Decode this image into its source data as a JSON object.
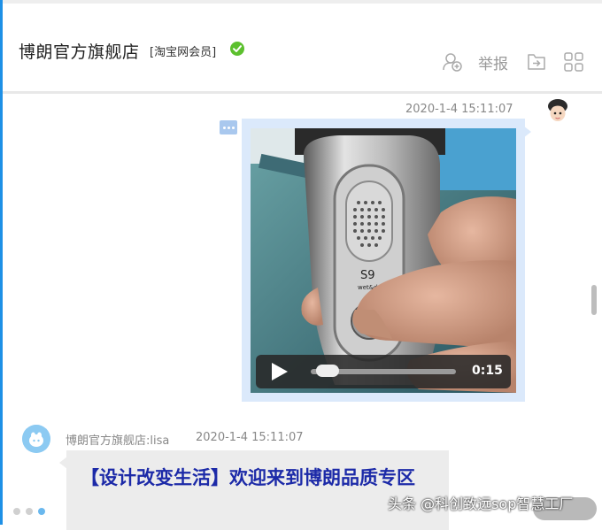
{
  "header": {
    "shop_name": "博朗官方旗舰店",
    "member_tag": "[淘宝网会员]",
    "report_label": "举报",
    "icons": [
      "verified-check-icon",
      "add-contact-icon",
      "transfer-icon",
      "grid-apps-icon"
    ]
  },
  "chat": {
    "my_message": {
      "timestamp": "2020-1-4 15:11:07",
      "type": "video",
      "video_model_label": "S9",
      "video_sub_label": "wet&dry",
      "video_duration": "0:15",
      "progress": 0.05
    },
    "shop_message": {
      "sender": "博朗官方旗舰店:lisa",
      "timestamp": "2020-1-4 15:11:07",
      "text": "【设计改变生活】欢迎来到博朗品质专区"
    }
  },
  "watermark": "头条 @科创致远sop智慧工厂",
  "colors": {
    "accent": "#1e90e6",
    "bubble_me": "#dbe9fb",
    "bubble_shop": "#ececec",
    "message_text": "#1c2aa8",
    "verified": "#5cc02e"
  }
}
